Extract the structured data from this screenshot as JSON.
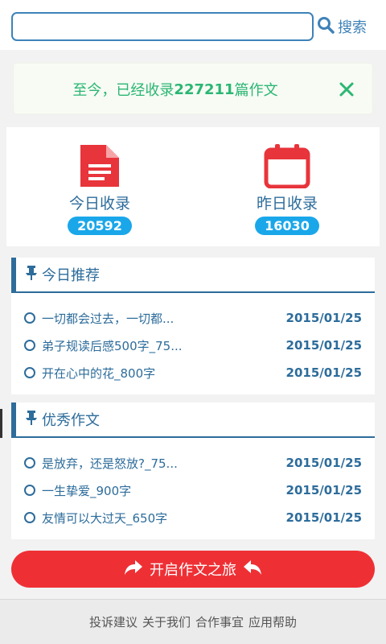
{
  "search": {
    "value": "",
    "placeholder": "",
    "button_label": "搜索"
  },
  "notice": {
    "prefix": "至今，已经收录",
    "count": "227211",
    "suffix": "篇作文"
  },
  "stats": {
    "today": {
      "label": "今日收录",
      "count": "20592"
    },
    "yesterday": {
      "label": "昨日收录",
      "count": "16030"
    }
  },
  "recommend": {
    "title": "今日推荐",
    "items": [
      {
        "title": "一切都会过去，一切都...",
        "date": "2015/01/25"
      },
      {
        "title": "弟子规读后感500字_75...",
        "date": "2015/01/25"
      },
      {
        "title": "开在心中的花_800字",
        "date": "2015/01/25"
      }
    ]
  },
  "excellent": {
    "title": "优秀作文",
    "items": [
      {
        "title": "是放弃，还是怒放?_75...",
        "date": "2015/01/25"
      },
      {
        "title": "一生挚爱_900字",
        "date": "2015/01/25"
      },
      {
        "title": "友情可以大过天_650字",
        "date": "2015/01/25"
      }
    ]
  },
  "start_button": {
    "label": "开启作文之旅"
  },
  "footer": {
    "links": [
      "投诉建议",
      "关于我们",
      "合作事宜",
      "应用帮助"
    ]
  },
  "colors": {
    "accent": "#2d6c9b",
    "green": "#2bb673",
    "red": "#ee3035",
    "badge": "#1aa7ea"
  },
  "icons": [
    "search-icon",
    "close-icon",
    "document-icon",
    "calendar-icon",
    "pin-icon",
    "share-icon",
    "return-icon"
  ]
}
